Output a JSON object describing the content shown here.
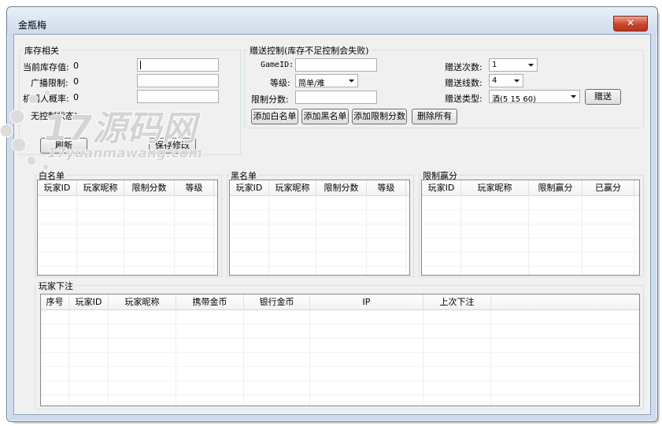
{
  "window": {
    "title": "金瓶梅",
    "close_glyph": "✕"
  },
  "inventory": {
    "legend": "库存相关",
    "current_label": "当前库存值:",
    "current_value": "0",
    "broadcast_label": "广播限制:",
    "broadcast_value": "0",
    "robot_label": "机器人概率:",
    "robot_value": "0",
    "status_label": "无控制状态!",
    "refresh_label": "刷新",
    "save_label": "保存修改"
  },
  "gift": {
    "legend": "赠送控制(库存不足控制会失败)",
    "gameid_label": "GameID:",
    "level_label": "等级:",
    "level_value": "简单/难",
    "limit_label": "限制分数:",
    "count_label": "赠送次数:",
    "count_value": "1",
    "lines_label": "赠送线数:",
    "lines_value": "4",
    "type_label": "赠送类型:",
    "type_value": "酒(5 15 60)",
    "send_label": "赠送",
    "add_white_label": "添加白名单",
    "add_black_label": "添加黑名单",
    "add_limit_label": "添加限制分数",
    "delete_all_label": "删除所有"
  },
  "whitelist": {
    "legend": "白名单",
    "columns": [
      "玩家ID",
      "玩家昵称",
      "限制分数",
      "等级"
    ]
  },
  "blacklist": {
    "legend": "黑名单",
    "columns": [
      "玩家ID",
      "玩家昵称",
      "限制分数",
      "等级"
    ]
  },
  "limitwin": {
    "legend": "限制赢分",
    "columns": [
      "玩家ID",
      "玩家昵称",
      "限制赢分",
      "已赢分"
    ]
  },
  "bets": {
    "legend": "玩家下注",
    "columns": [
      "序号",
      "玩家ID",
      "玩家昵称",
      "携带金币",
      "银行金币",
      "IP",
      "上次下注"
    ]
  },
  "watermark": {
    "main": "17源码网",
    "sub": "17yuanmawang.com"
  }
}
